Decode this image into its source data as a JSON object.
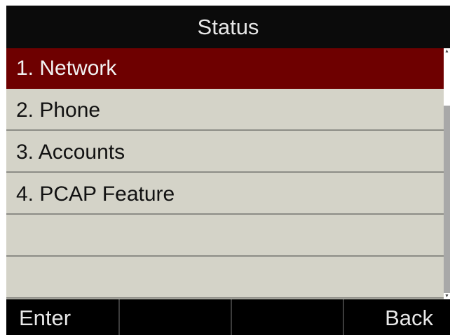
{
  "title": "Status",
  "menu": {
    "items": [
      {
        "label": "1. Network",
        "selected": true
      },
      {
        "label": "2. Phone",
        "selected": false
      },
      {
        "label": "3. Accounts",
        "selected": false
      },
      {
        "label": "4. PCAP Feature",
        "selected": false
      },
      {
        "label": "",
        "selected": false
      },
      {
        "label": "",
        "selected": false
      }
    ]
  },
  "softkeys": [
    {
      "label": "Enter"
    },
    {
      "label": ""
    },
    {
      "label": ""
    },
    {
      "label": "Back"
    }
  ],
  "colors": {
    "title_bg": "#0b0b0b",
    "selected_bg": "#6e0000",
    "list_bg": "#d4d3c8",
    "softkey_bg": "#000000"
  }
}
